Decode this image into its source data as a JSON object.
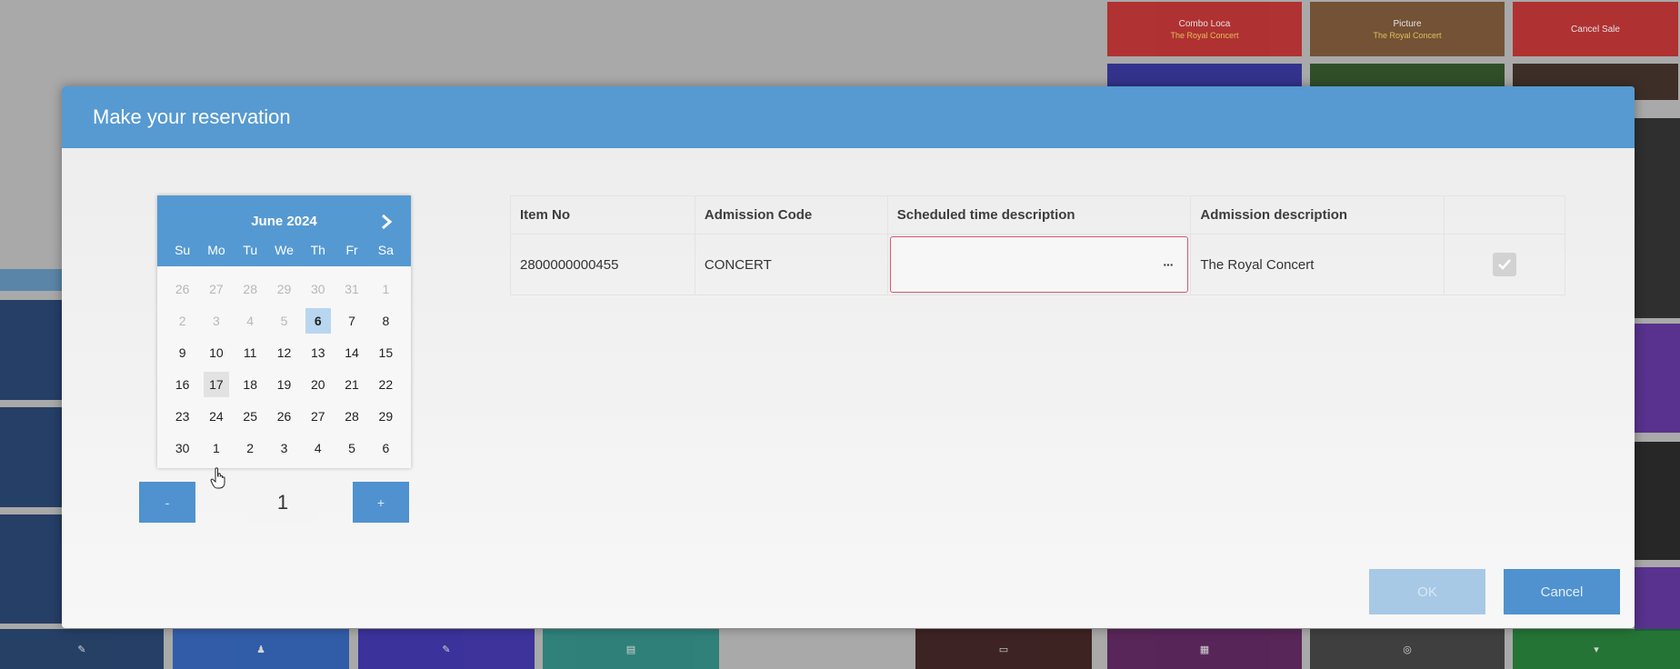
{
  "background_tiles": [
    {
      "label": "Combo Loca",
      "sub": "The Royal Concert"
    },
    {
      "label": "Picture",
      "sub": "The Royal Concert"
    },
    {
      "label": "Cancel Sale",
      "sub": ""
    }
  ],
  "dialog": {
    "title": "Make your reservation"
  },
  "calendar": {
    "month_label": "June 2024",
    "weekdays": [
      "Su",
      "Mo",
      "Tu",
      "We",
      "Th",
      "Fr",
      "Sa"
    ],
    "days": [
      {
        "d": "26",
        "other": true
      },
      {
        "d": "27",
        "other": true
      },
      {
        "d": "28",
        "other": true
      },
      {
        "d": "29",
        "other": true
      },
      {
        "d": "30",
        "other": true
      },
      {
        "d": "31",
        "other": true
      },
      {
        "d": "1",
        "other": true
      },
      {
        "d": "2",
        "other": true
      },
      {
        "d": "3",
        "other": true
      },
      {
        "d": "4",
        "other": true
      },
      {
        "d": "5",
        "other": true
      },
      {
        "d": "6",
        "today": true
      },
      {
        "d": "7"
      },
      {
        "d": "8"
      },
      {
        "d": "9"
      },
      {
        "d": "10"
      },
      {
        "d": "11"
      },
      {
        "d": "12"
      },
      {
        "d": "13"
      },
      {
        "d": "14"
      },
      {
        "d": "15"
      },
      {
        "d": "16"
      },
      {
        "d": "17",
        "hover": true
      },
      {
        "d": "18"
      },
      {
        "d": "19"
      },
      {
        "d": "20"
      },
      {
        "d": "21"
      },
      {
        "d": "22"
      },
      {
        "d": "23"
      },
      {
        "d": "24"
      },
      {
        "d": "25"
      },
      {
        "d": "26"
      },
      {
        "d": "27"
      },
      {
        "d": "28"
      },
      {
        "d": "29"
      },
      {
        "d": "30"
      },
      {
        "d": "1"
      },
      {
        "d": "2"
      },
      {
        "d": "3"
      },
      {
        "d": "4"
      },
      {
        "d": "5"
      },
      {
        "d": "6"
      }
    ]
  },
  "quantity": {
    "minus_label": "-",
    "plus_label": "+",
    "value": "1"
  },
  "table": {
    "headers": [
      "Item No",
      "Admission Code",
      "Scheduled time description",
      "Admission description",
      ""
    ],
    "rows": [
      {
        "item_no": "2800000000455",
        "admission_code": "CONCERT",
        "scheduled_time": "",
        "ellipsis": "···",
        "admission_description": "The Royal Concert",
        "checked": true
      }
    ]
  },
  "buttons": {
    "ok_label": "OK",
    "cancel_label": "Cancel"
  },
  "colors": {
    "header": "#569ad1",
    "accent": "#4f92cf",
    "error_border": "#d9566b"
  }
}
